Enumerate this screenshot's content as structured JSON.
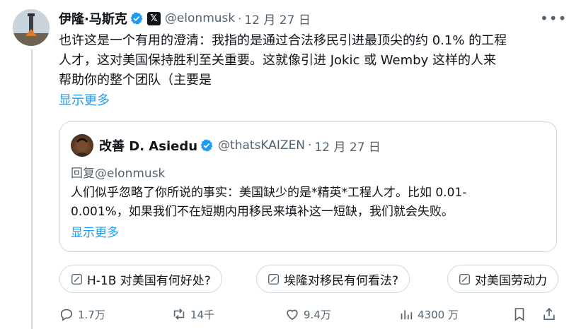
{
  "author": {
    "name": "伊隆·马斯克",
    "handle": "@elonmusk",
    "date": "12 月 27 日"
  },
  "tweet": {
    "line1": "也许这是一个有用的澄清：我指的是通过合法移民引进最顶尖的约 0.1% 的工程",
    "line2": "人才，这对美国保持胜利至关重要。这就像引进 Jokic 或 Wemby 这样的人来",
    "line3": "帮助你的整个团队（主要是",
    "show_more": "显示更多"
  },
  "quote": {
    "name": "改善 D. Asiedu",
    "handle": "@thatsKAIZEN",
    "date": "12 月 27 日",
    "reply_to": "回复@elonmusk",
    "line1": "人们似乎忽略了你所说的事实：美国缺少的是*精英*工程人才。比如 0.01-",
    "line2": "0.001%，如果我们不在短期内用移民来填补这一短缺，我们就会失败。",
    "show_more": "显示更多"
  },
  "chips": [
    {
      "label": "H-1B 对美国有何好处?"
    },
    {
      "label": "埃隆对移民有何看法?"
    },
    {
      "label": "对美国劳动力"
    }
  ],
  "actions": {
    "replies": "1.7万",
    "reposts": "14千",
    "likes": "9.4万",
    "views": "4300 万"
  },
  "colors": {
    "accent": "#1d9bf0",
    "muted": "#536471",
    "border": "#cfd9de",
    "text": "#0f1419"
  },
  "icons": [
    "verified-badge-icon",
    "x-logo-icon",
    "more-icon",
    "grok-prompt-icon",
    "reply-icon",
    "repost-icon",
    "like-icon",
    "views-icon",
    "bookmark-icon",
    "share-icon"
  ]
}
